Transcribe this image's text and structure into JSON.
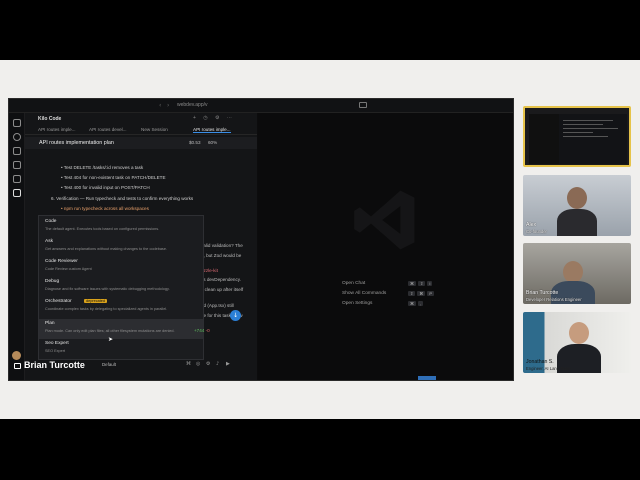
{
  "browser": {
    "address": "webdev.app/v"
  },
  "extension": {
    "title": "Kilo Code",
    "tabs": [
      "API routes imple...",
      "API routes devel...",
      "New Session",
      "API routes imple..."
    ],
    "task_title": "API routes implementation plan",
    "cost": "$0.53",
    "context_pct": "60%"
  },
  "plan_lines": [
    "• Test DELETE /tasks/:id removes a task",
    "• Test 404 for non-existent task on PATCH/DELETE",
    "• Test 400 for invalid input on POST/PATCH",
    "6. Verification — Run typecheck and tests to confirm everything works",
    "• npm run typecheck across all workspaces",
    "• npm test to run the test suite"
  ],
  "partial_right": [
    "valid validation? The",
    "ft, but Zod would be",
    "rizzle-kit",
    "its devDependency.",
    "s clean up after itself",
    "nd (App.tsx) still",
    "pe for this task. Now"
  ],
  "mode_menu": [
    {
      "name": "Code",
      "desc": "The default agent. Executes tools based on configured permissions."
    },
    {
      "name": "Ask",
      "desc": "Get answers and explanations without making changes to the codebase."
    },
    {
      "name": "Code Reviewer",
      "desc": "Code Review custom Agent"
    },
    {
      "name": "Debug",
      "desc": "Diagnose and fix software issues with systematic debugging methodology."
    },
    {
      "name": "Orchestrator",
      "badge": "deprecated",
      "desc": "Coordinate complex tasks by delegating to specialized agents in parallel."
    },
    {
      "name": "Plan",
      "desc": "Plan mode. Can only edit plan files; all other filesystem mutations are denied."
    },
    {
      "name": "Seo Expert",
      "desc": "SEO Expert"
    }
  ],
  "diff": {
    "added": "+744",
    "removed": "-0"
  },
  "input_bar": {
    "model": "Default"
  },
  "welcome_commands": [
    {
      "label": "Open Chat",
      "keys": [
        "⌘",
        "⇧",
        "I"
      ]
    },
    {
      "label": "Show All Commands",
      "keys": [
        "⇧",
        "⌘",
        "P"
      ]
    },
    {
      "label": "Open Settings",
      "keys": [
        "⌘",
        ","
      ]
    }
  ],
  "presenter": {
    "name": "Brian Turcotte"
  },
  "participants": [
    {
      "name": "Alex",
      "role": "Co-founder"
    },
    {
      "name": "Brian Turcotte",
      "role": "Developer Relations Engineer"
    },
    {
      "name": "Jonathan S.",
      "role": "Engineer, AI Lang Team"
    }
  ],
  "colors": {
    "accent": "#3a8ee6",
    "badge": "#d9a21b",
    "active_speaker": "#e6c34a"
  }
}
